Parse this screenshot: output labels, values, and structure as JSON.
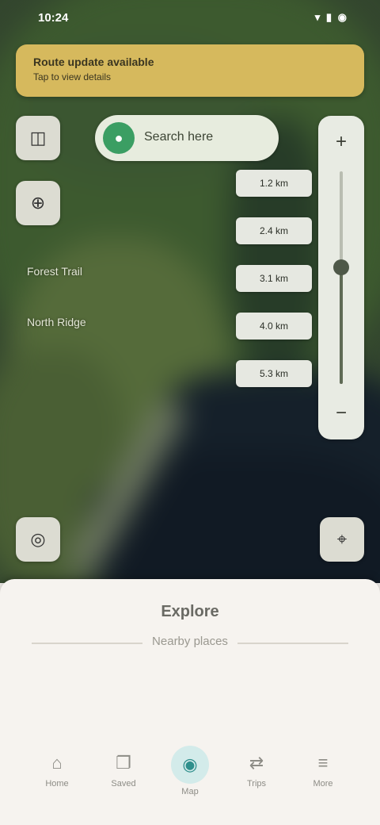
{
  "status_bar": {
    "time": "10:24",
    "icons": "▾ ▮ ◉"
  },
  "banner": {
    "title": "Route update available",
    "subtitle": "Tap to view details"
  },
  "search": {
    "icon": "location-pin-icon",
    "text": "Search here"
  },
  "map": {
    "labels": [
      "Forest Trail",
      "North Ridge"
    ],
    "buttons": {
      "layers_icon": "layers-icon",
      "compass_icon": "compass-icon",
      "locate_left_icon": "recenter-icon",
      "locate_right_icon": "my-location-icon"
    }
  },
  "route_steps": [
    "1.2 km",
    "2.4 km",
    "3.1 km",
    "4.0 km",
    "5.3 km"
  ],
  "zoom": {
    "level_fraction": 0.55,
    "in_label": "+",
    "out_label": "−"
  },
  "sheet": {
    "title": "Explore",
    "subtitle": "Nearby places"
  },
  "bottom_nav": {
    "items": [
      {
        "label": "Home",
        "icon": "home-icon",
        "glyph": "⌂"
      },
      {
        "label": "Saved",
        "icon": "bookmark-icon",
        "glyph": "❐"
      },
      {
        "label": "Map",
        "icon": "map-icon",
        "glyph": "◉",
        "active": true
      },
      {
        "label": "Trips",
        "icon": "route-icon",
        "glyph": "⇄"
      },
      {
        "label": "More",
        "icon": "menu-icon",
        "glyph": "≡"
      }
    ]
  },
  "colors": {
    "banner": "#d6b95d",
    "accent": "#2f8f8c",
    "search_dot": "#3b9e63"
  }
}
